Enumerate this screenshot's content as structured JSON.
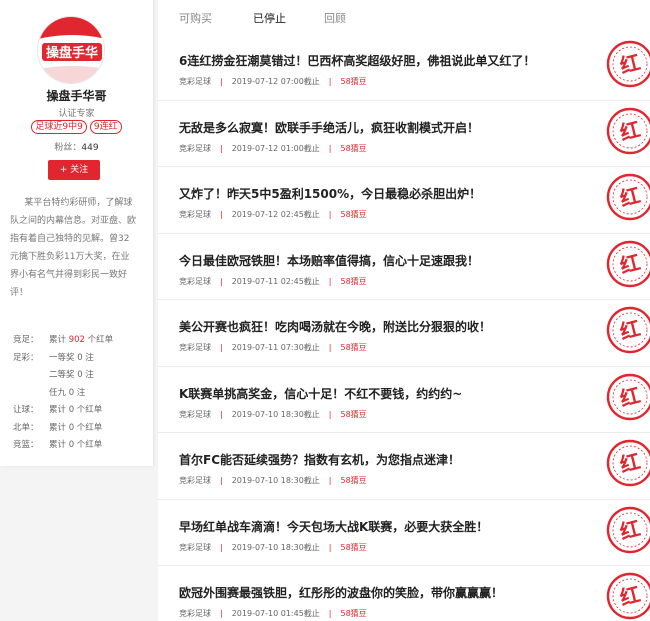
{
  "profile": {
    "avatar_text": "操盘手华",
    "nickname": "操盘手华哥",
    "certification": "认证专家",
    "badges": [
      "足球近9中9",
      "9连红"
    ],
    "fans_label": "粉丝：",
    "fans_count": "449",
    "follow_label": "+ 关注",
    "description": "某平台特约彩研师，了解球队之间的内幕信息。对亚盘、欧指有着自己独特的见解。曾32元擒下胜负彩11万大奖，在业界小有名气并得到彩民一致好评！",
    "stats": [
      {
        "label": "竞足：",
        "prefix": "累计 ",
        "value": "902",
        "suffix": " 个红单",
        "highlight": true
      },
      {
        "label": "足彩：",
        "prefix": "",
        "value": "一等奖 0 注",
        "suffix": "",
        "highlight": false
      },
      {
        "label": "",
        "prefix": "",
        "value": "二等奖 0 注",
        "suffix": "",
        "highlight": false
      },
      {
        "label": "",
        "prefix": "",
        "value": "任九 0 注",
        "suffix": "",
        "highlight": false
      },
      {
        "label": "让球：",
        "prefix": "",
        "value": "累计 0 个红单",
        "suffix": "",
        "highlight": false
      },
      {
        "label": "北单：",
        "prefix": "",
        "value": "累计 0 个红单",
        "suffix": "",
        "highlight": false
      },
      {
        "label": "竞篮：",
        "prefix": "",
        "value": "累计 0 个红单",
        "suffix": "",
        "highlight": false
      }
    ]
  },
  "tabs": [
    "可购买",
    "已停止",
    "回顾"
  ],
  "active_tab": 1,
  "stamp_text": "红",
  "colors": {
    "accent": "#e0262f"
  },
  "articles": [
    {
      "title": "6连红捞金狂潮莫错过！巴西杯高奖超级好胆，佛祖说此单又红了！",
      "category": "竞彩足球",
      "deadline": "2019-07-12 07:00截止",
      "price": "58猜豆"
    },
    {
      "title": "无敌是多么寂寞！欧联手手绝活儿，疯狂收割模式开启！",
      "category": "竞彩足球",
      "deadline": "2019-07-12 01:00截止",
      "price": "58猜豆"
    },
    {
      "title": "又炸了！昨天5中5盈利1500%，今日最稳必杀胆出炉！",
      "category": "竞彩足球",
      "deadline": "2019-07-12 02:45截止",
      "price": "58猜豆"
    },
    {
      "title": "今日最佳欧冠铁胆！本场赔率值得搞，信心十足速跟我！",
      "category": "竞彩足球",
      "deadline": "2019-07-11 02:45截止",
      "price": "58猜豆"
    },
    {
      "title": "美公开赛也疯狂！吃肉喝汤就在今晚，附送比分狠狠的收！",
      "category": "竞彩足球",
      "deadline": "2019-07-11 07:30截止",
      "price": "58猜豆"
    },
    {
      "title": "K联赛单挑高奖金，信心十足！不红不要钱，约约约~",
      "category": "竞彩足球",
      "deadline": "2019-07-10 18:30截止",
      "price": "58猜豆"
    },
    {
      "title": "首尔FC能否延续强势？指数有玄机，为您指点迷津！",
      "category": "竞彩足球",
      "deadline": "2019-07-10 18:30截止",
      "price": "58猜豆"
    },
    {
      "title": "早场红单战车滴滴！今天包场大战K联赛，必要大获全胜！",
      "category": "竞彩足球",
      "deadline": "2019-07-10 18:30截止",
      "price": "58猜豆"
    },
    {
      "title": "欧冠外围赛最强铁胆，红彤彤的波盘你的笑脸，带你赢赢赢！",
      "category": "竞彩足球",
      "deadline": "2019-07-10 01:45截止",
      "price": "58猜豆"
    }
  ]
}
